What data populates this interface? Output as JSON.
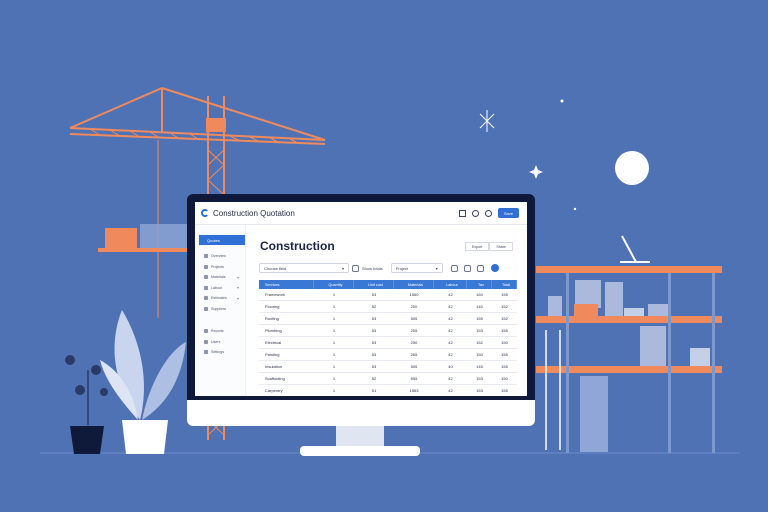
{
  "app": {
    "title": "Construction Quotation",
    "header_button": "Save"
  },
  "sidebar": {
    "active_item": "Quotes",
    "items": [
      {
        "label": "Overview",
        "caret": ""
      },
      {
        "label": "Projects",
        "caret": ""
      },
      {
        "label": "Materials",
        "caret": "▾"
      },
      {
        "label": "Labour",
        "caret": "▾"
      },
      {
        "label": "Estimates",
        "caret": "▾"
      },
      {
        "label": "Suppliers",
        "caret": ""
      }
    ],
    "lower_items": [
      {
        "label": "Reports"
      },
      {
        "label": "Users"
      },
      {
        "label": "Settings"
      }
    ]
  },
  "main": {
    "page_title": "Construction",
    "header_buttons": [
      "Export",
      "Share"
    ],
    "filters": {
      "select_value": "Choose field",
      "label_1": "Show totals",
      "select_2_value": "Project"
    },
    "table": {
      "columns": [
        "Services",
        "Quantity",
        "Unit cost",
        "Materials",
        "Labour",
        "Tax",
        "Total"
      ],
      "rows": [
        [
          "Framework",
          "1",
          "53",
          "1560",
          "42",
          "160",
          "155"
        ],
        [
          "Flooring",
          "1",
          "52",
          "200",
          "42",
          "140",
          "152"
        ],
        [
          "Roofing",
          "1",
          "53",
          "505",
          "42",
          "155",
          "152"
        ],
        [
          "Plumbing",
          "1",
          "53",
          "205",
          "42",
          "153",
          "155"
        ],
        [
          "Electrical",
          "1",
          "53",
          "250",
          "42",
          "152",
          "150"
        ],
        [
          "Painting",
          "1",
          "53",
          "265",
          "42",
          "150",
          "155"
        ],
        [
          "Insulation",
          "1",
          "53",
          "505",
          "40",
          "145",
          "155"
        ],
        [
          "Scaffolding",
          "1",
          "52",
          "555",
          "42",
          "153",
          "150"
        ],
        [
          "Carpentry",
          "1",
          "51",
          "1563",
          "42",
          "153",
          "155"
        ],
        [
          "Demolition",
          "1",
          "51",
          "252",
          "42",
          "155",
          "150"
        ]
      ]
    }
  },
  "colors": {
    "background": "#4f72b5",
    "crane": "#f08a5d",
    "accent": "#2f6fd6",
    "monitor": "#0f1a3a"
  },
  "icons": [
    "crane-illustration",
    "plant-illustration",
    "shelving-illustration",
    "moon-icon",
    "sparkle-icon"
  ]
}
